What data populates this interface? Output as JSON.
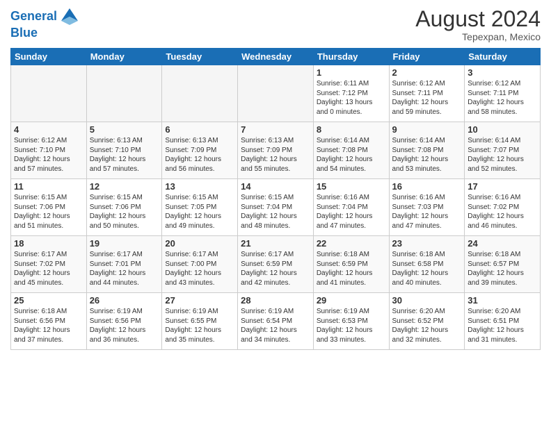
{
  "header": {
    "logo_line1": "General",
    "logo_line2": "Blue",
    "month_year": "August 2024",
    "location": "Tepexpan, Mexico"
  },
  "weekdays": [
    "Sunday",
    "Monday",
    "Tuesday",
    "Wednesday",
    "Thursday",
    "Friday",
    "Saturday"
  ],
  "weeks": [
    [
      {
        "day": "",
        "info": ""
      },
      {
        "day": "",
        "info": ""
      },
      {
        "day": "",
        "info": ""
      },
      {
        "day": "",
        "info": ""
      },
      {
        "day": "1",
        "info": "Sunrise: 6:11 AM\nSunset: 7:12 PM\nDaylight: 13 hours\nand 0 minutes."
      },
      {
        "day": "2",
        "info": "Sunrise: 6:12 AM\nSunset: 7:11 PM\nDaylight: 12 hours\nand 59 minutes."
      },
      {
        "day": "3",
        "info": "Sunrise: 6:12 AM\nSunset: 7:11 PM\nDaylight: 12 hours\nand 58 minutes."
      }
    ],
    [
      {
        "day": "4",
        "info": "Sunrise: 6:12 AM\nSunset: 7:10 PM\nDaylight: 12 hours\nand 57 minutes."
      },
      {
        "day": "5",
        "info": "Sunrise: 6:13 AM\nSunset: 7:10 PM\nDaylight: 12 hours\nand 57 minutes."
      },
      {
        "day": "6",
        "info": "Sunrise: 6:13 AM\nSunset: 7:09 PM\nDaylight: 12 hours\nand 56 minutes."
      },
      {
        "day": "7",
        "info": "Sunrise: 6:13 AM\nSunset: 7:09 PM\nDaylight: 12 hours\nand 55 minutes."
      },
      {
        "day": "8",
        "info": "Sunrise: 6:14 AM\nSunset: 7:08 PM\nDaylight: 12 hours\nand 54 minutes."
      },
      {
        "day": "9",
        "info": "Sunrise: 6:14 AM\nSunset: 7:08 PM\nDaylight: 12 hours\nand 53 minutes."
      },
      {
        "day": "10",
        "info": "Sunrise: 6:14 AM\nSunset: 7:07 PM\nDaylight: 12 hours\nand 52 minutes."
      }
    ],
    [
      {
        "day": "11",
        "info": "Sunrise: 6:15 AM\nSunset: 7:06 PM\nDaylight: 12 hours\nand 51 minutes."
      },
      {
        "day": "12",
        "info": "Sunrise: 6:15 AM\nSunset: 7:06 PM\nDaylight: 12 hours\nand 50 minutes."
      },
      {
        "day": "13",
        "info": "Sunrise: 6:15 AM\nSunset: 7:05 PM\nDaylight: 12 hours\nand 49 minutes."
      },
      {
        "day": "14",
        "info": "Sunrise: 6:15 AM\nSunset: 7:04 PM\nDaylight: 12 hours\nand 48 minutes."
      },
      {
        "day": "15",
        "info": "Sunrise: 6:16 AM\nSunset: 7:04 PM\nDaylight: 12 hours\nand 47 minutes."
      },
      {
        "day": "16",
        "info": "Sunrise: 6:16 AM\nSunset: 7:03 PM\nDaylight: 12 hours\nand 47 minutes."
      },
      {
        "day": "17",
        "info": "Sunrise: 6:16 AM\nSunset: 7:02 PM\nDaylight: 12 hours\nand 46 minutes."
      }
    ],
    [
      {
        "day": "18",
        "info": "Sunrise: 6:17 AM\nSunset: 7:02 PM\nDaylight: 12 hours\nand 45 minutes."
      },
      {
        "day": "19",
        "info": "Sunrise: 6:17 AM\nSunset: 7:01 PM\nDaylight: 12 hours\nand 44 minutes."
      },
      {
        "day": "20",
        "info": "Sunrise: 6:17 AM\nSunset: 7:00 PM\nDaylight: 12 hours\nand 43 minutes."
      },
      {
        "day": "21",
        "info": "Sunrise: 6:17 AM\nSunset: 6:59 PM\nDaylight: 12 hours\nand 42 minutes."
      },
      {
        "day": "22",
        "info": "Sunrise: 6:18 AM\nSunset: 6:59 PM\nDaylight: 12 hours\nand 41 minutes."
      },
      {
        "day": "23",
        "info": "Sunrise: 6:18 AM\nSunset: 6:58 PM\nDaylight: 12 hours\nand 40 minutes."
      },
      {
        "day": "24",
        "info": "Sunrise: 6:18 AM\nSunset: 6:57 PM\nDaylight: 12 hours\nand 39 minutes."
      }
    ],
    [
      {
        "day": "25",
        "info": "Sunrise: 6:18 AM\nSunset: 6:56 PM\nDaylight: 12 hours\nand 37 minutes."
      },
      {
        "day": "26",
        "info": "Sunrise: 6:19 AM\nSunset: 6:56 PM\nDaylight: 12 hours\nand 36 minutes."
      },
      {
        "day": "27",
        "info": "Sunrise: 6:19 AM\nSunset: 6:55 PM\nDaylight: 12 hours\nand 35 minutes."
      },
      {
        "day": "28",
        "info": "Sunrise: 6:19 AM\nSunset: 6:54 PM\nDaylight: 12 hours\nand 34 minutes."
      },
      {
        "day": "29",
        "info": "Sunrise: 6:19 AM\nSunset: 6:53 PM\nDaylight: 12 hours\nand 33 minutes."
      },
      {
        "day": "30",
        "info": "Sunrise: 6:20 AM\nSunset: 6:52 PM\nDaylight: 12 hours\nand 32 minutes."
      },
      {
        "day": "31",
        "info": "Sunrise: 6:20 AM\nSunset: 6:51 PM\nDaylight: 12 hours\nand 31 minutes."
      }
    ]
  ]
}
